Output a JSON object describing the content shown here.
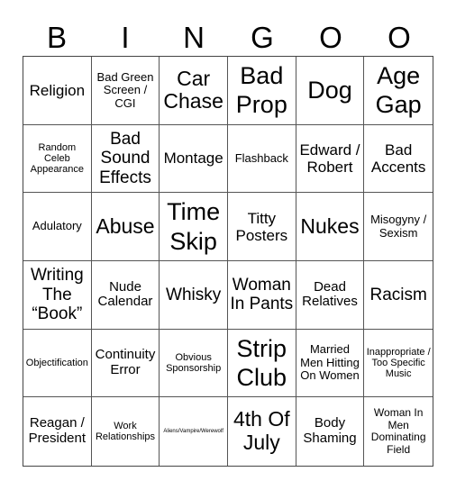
{
  "header": {
    "letters": [
      "B",
      "I",
      "N",
      "G",
      "O",
      "O"
    ]
  },
  "grid": {
    "cells": [
      {
        "text": "Religion",
        "size": "s-m"
      },
      {
        "text": "Bad Green Screen / CGI",
        "size": "s-s"
      },
      {
        "text": "Car Chase",
        "size": "s-l"
      },
      {
        "text": "Bad Prop",
        "size": "s-xl"
      },
      {
        "text": "Dog",
        "size": "s-xl"
      },
      {
        "text": "Age Gap",
        "size": "s-xl"
      },
      {
        "text": "Random Celeb Appearance",
        "size": "s-xxs"
      },
      {
        "text": "Bad Sound Effects",
        "size": "s-ml"
      },
      {
        "text": "Montage",
        "size": "s-m"
      },
      {
        "text": "Flashback",
        "size": "s-s"
      },
      {
        "text": "Edward / Robert",
        "size": "s-m"
      },
      {
        "text": "Bad Accents",
        "size": "s-m"
      },
      {
        "text": "Adulatory",
        "size": "s-s"
      },
      {
        "text": "Abuse",
        "size": "s-l"
      },
      {
        "text": "Time Skip",
        "size": "s-xl"
      },
      {
        "text": "Titty Posters",
        "size": "s-m"
      },
      {
        "text": "Nukes",
        "size": "s-l"
      },
      {
        "text": "Misogyny / Sexism",
        "size": "s-s"
      },
      {
        "text": "Writing The “Book”",
        "size": "s-ml"
      },
      {
        "text": "Nude Calendar",
        "size": "s-sm"
      },
      {
        "text": "Whisky",
        "size": "s-ml"
      },
      {
        "text": "Woman In Pants",
        "size": "s-ml"
      },
      {
        "text": "Dead Relatives",
        "size": "s-sm"
      },
      {
        "text": "Racism",
        "size": "s-ml"
      },
      {
        "text": "Objectification",
        "size": "s-xxs"
      },
      {
        "text": "Continuity Error",
        "size": "s-sm"
      },
      {
        "text": "Obvious Sponsorship",
        "size": "s-xxs"
      },
      {
        "text": "Strip Club",
        "size": "s-xl"
      },
      {
        "text": "Married Men Hitting On Women",
        "size": "s-s"
      },
      {
        "text": "Inappropriate / Too Specific Music",
        "size": "s-xxs"
      },
      {
        "text": "Reagan / President",
        "size": "s-sm"
      },
      {
        "text": "Work Relationships",
        "size": "s-xxs"
      },
      {
        "text": "Aliens/Vampire/Werewolf",
        "size": "s-tiny"
      },
      {
        "text": "4th Of July",
        "size": "s-l"
      },
      {
        "text": "Body Shaming",
        "size": "s-sm"
      },
      {
        "text": "Woman In Men Dominating Field",
        "size": "s-xs"
      }
    ]
  }
}
